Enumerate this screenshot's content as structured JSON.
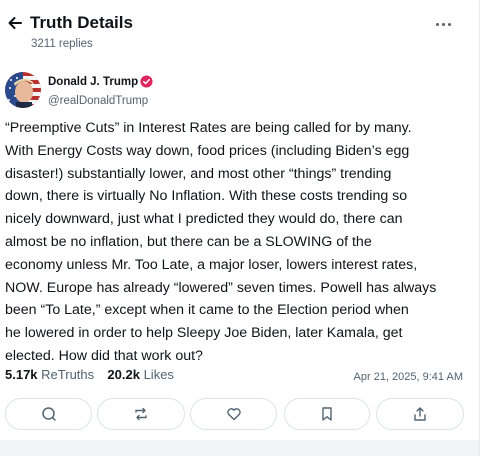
{
  "header": {
    "title": "Truth Details",
    "replies": "3211 replies"
  },
  "author": {
    "name": "Donald J. Trump",
    "handle": "@realDonaldTrump"
  },
  "post": {
    "text": "“Preemptive Cuts” in Interest Rates are being called for by many.\nWith Energy Costs way down, food prices (including Biden’s egg\ndisaster!) substantially lower, and most other “things” trending\ndown, there is virtually No Inflation. With these costs trending so\nnicely downward, just what I predicted they would do, there can\nalmost be no inflation, but there can be a SLOWING of the\neconomy unless Mr. Too Late, a major loser, lowers interest rates,\nNOW. Europe has already “lowered” seven times. Powell has always\nbeen “To Late,” except when it came to the Election period when\nhe lowered in order to help Sleepy Joe Biden, later Kamala, get\nelected. How did that work out?"
  },
  "stats": {
    "retruths_count": "5.17k",
    "retruths_label": "ReTruths",
    "likes_count": "20.2k",
    "likes_label": "Likes",
    "timestamp": "Apr 21, 2025, 9:41 AM"
  },
  "actions": [
    {
      "icon": "reply-icon"
    },
    {
      "icon": "retruth-icon"
    },
    {
      "icon": "heart-icon"
    },
    {
      "icon": "bookmark-icon"
    },
    {
      "icon": "share-icon"
    }
  ],
  "colors": {
    "verified_badge": "#e0245e",
    "secondary_text": "#536471",
    "border": "#dfe3e6"
  }
}
